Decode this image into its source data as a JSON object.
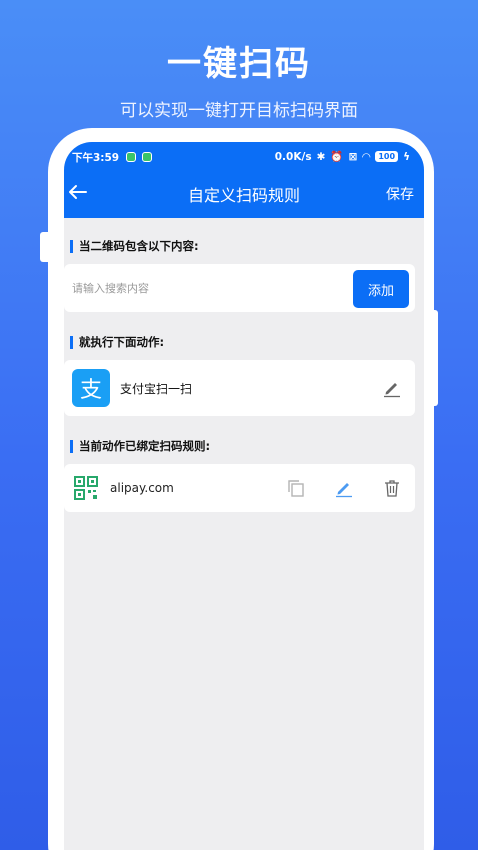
{
  "promo": {
    "title": "一键扫码",
    "subtitle": "可以实现一键打开目标扫码界面"
  },
  "status_bar": {
    "time": "下午3:59",
    "speed": "0.0K/s",
    "battery": "100"
  },
  "app_bar": {
    "title": "自定义扫码规则",
    "save_label": "保存",
    "back_icon": "arrow-left-icon"
  },
  "sections": {
    "match_label": "当二维码包含以下内容:",
    "action_label": "就执行下面动作:",
    "bound_label": "当前动作已绑定扫码规则:"
  },
  "search": {
    "placeholder": "请输入搜索内容",
    "value": "",
    "add_label": "添加"
  },
  "action": {
    "icon_glyph": "支",
    "name": "支付宝扫一扫"
  },
  "rules": [
    {
      "domain": "alipay.com"
    }
  ],
  "colors": {
    "accent": "#0b6ef6",
    "background_top": "#4a8ef7",
    "alipay": "#1a9ff5"
  }
}
